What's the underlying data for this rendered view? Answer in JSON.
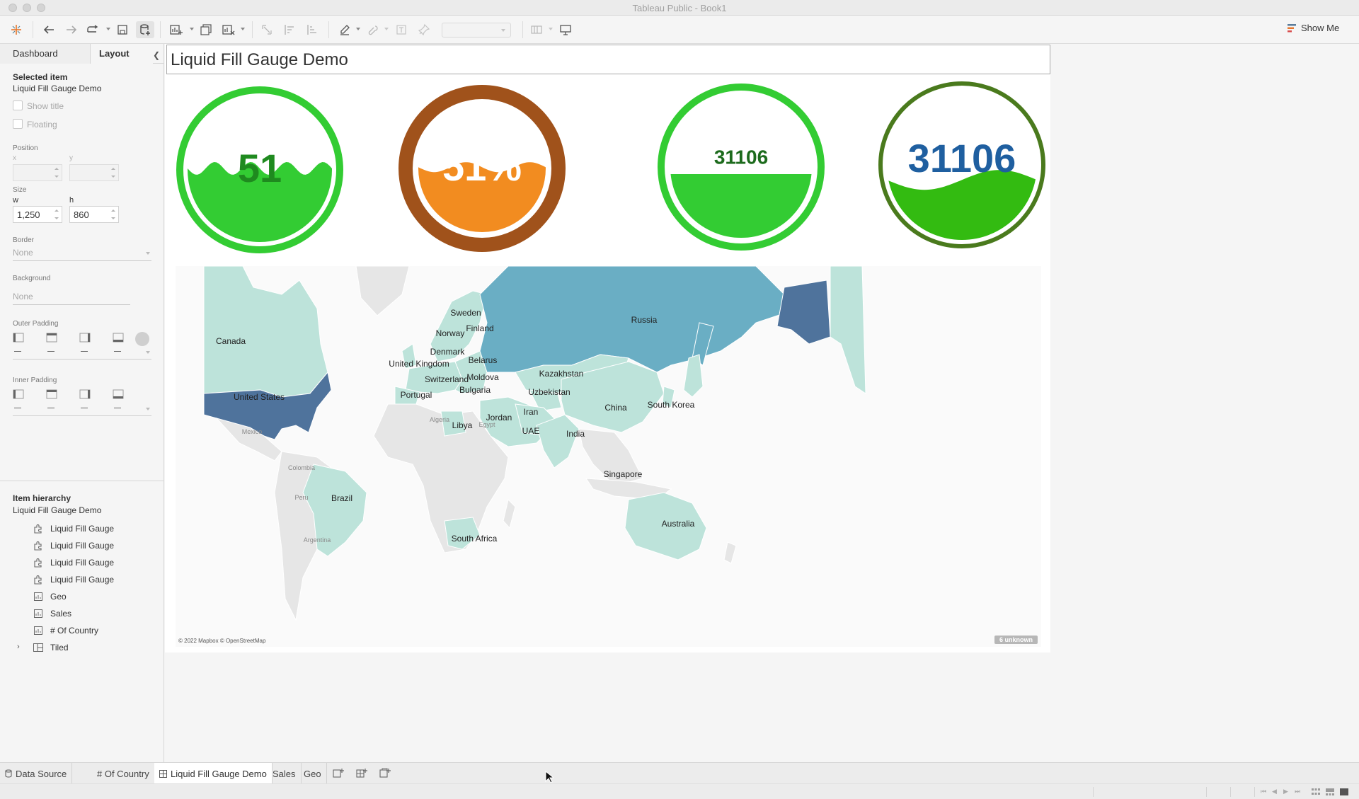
{
  "window": {
    "title": "Tableau Public - Book1"
  },
  "toolbar": {
    "show_me_label": "Show Me"
  },
  "left_pane": {
    "tabs": [
      "Dashboard",
      "Layout"
    ],
    "selected_item_heading": "Selected item",
    "selected_item_name": "Liquid Fill Gauge Demo",
    "show_title_label": "Show title",
    "floating_label": "Floating",
    "position_label": "Position",
    "x_label": "x",
    "y_label": "y",
    "size_label": "Size",
    "w_label": "w",
    "h_label": "h",
    "w_value": "1,250",
    "h_value": "860",
    "border_label": "Border",
    "border_value": "None",
    "background_label": "Background",
    "background_value": "None",
    "outer_padding_label": "Outer Padding",
    "inner_padding_label": "Inner Padding",
    "hierarchy_heading": "Item hierarchy",
    "hierarchy_root": "Liquid Fill Gauge Demo",
    "hierarchy_items": [
      {
        "label": "Liquid Fill Gauge",
        "icon": "extension-icon"
      },
      {
        "label": "Liquid Fill Gauge",
        "icon": "extension-icon"
      },
      {
        "label": "Liquid Fill Gauge",
        "icon": "extension-icon"
      },
      {
        "label": "Liquid Fill Gauge",
        "icon": "extension-icon"
      },
      {
        "label": "Geo",
        "icon": "sheet-icon"
      },
      {
        "label": "Sales",
        "icon": "sheet-icon"
      },
      {
        "label": "# Of Country",
        "icon": "sheet-icon"
      },
      {
        "label": "Tiled",
        "icon": "tiled-container-icon"
      }
    ]
  },
  "dashboard": {
    "title": "Liquid Fill Gauge Demo",
    "gauges": [
      {
        "text": "51",
        "fill_fraction": 0.51,
        "ring_color": "#33cc33",
        "fill_color": "#33cc33",
        "text_color": "#1f8a1f",
        "text_over_color": "#1f8a1f"
      },
      {
        "text": "51%",
        "fill_fraction": 0.51,
        "ring_color": "#a0521b",
        "fill_color": "#f28c20",
        "text_color": "#ffffff",
        "text_over_color": "#ffffff"
      },
      {
        "text": "31106",
        "fill_fraction": 0.45,
        "ring_color": "#33cc33",
        "fill_color": "#33cc33",
        "text_color": "#1d6b1d",
        "text_over_color": "#1d6b1d"
      },
      {
        "text": "31106",
        "fill_fraction": 0.4,
        "ring_color": "#4a7a1d",
        "fill_color": "#33bb11",
        "text_color": "#1f5fa0",
        "text_over_color": "#1f5fa0"
      }
    ],
    "map": {
      "attribution": "© 2022 Mapbox © OpenStreetMap",
      "unknown_badge": "6 unknown",
      "labels": [
        "Russia",
        "Canada",
        "United States",
        "Sweden",
        "Finland",
        "Norway",
        "Denmark",
        "United Kingdom",
        "Belarus",
        "Switzerland",
        "Moldova",
        "Kazakhstan",
        "Portugal",
        "Bulgaria",
        "Uzbekistan",
        "China",
        "South Korea",
        "Libya",
        "Jordan",
        "Iran",
        "UAE",
        "India",
        "Singapore",
        "Brazil",
        "Australia",
        "South Africa"
      ],
      "faint_labels": [
        "Algeria",
        "Egypt",
        "Mexico",
        "Colombia",
        "Peru",
        "Argentina"
      ],
      "colors": {
        "dark": "#4f739c",
        "mid": "#6aaec4",
        "light": "#bde3da",
        "land": "#e6e6e6",
        "water": "#fafafa"
      }
    }
  },
  "sheet_tabs": [
    "Data Source",
    "# Of Country",
    "Liquid Fill Gauge Demo",
    "Sales",
    "Geo"
  ],
  "active_sheet": "Liquid Fill Gauge Demo"
}
